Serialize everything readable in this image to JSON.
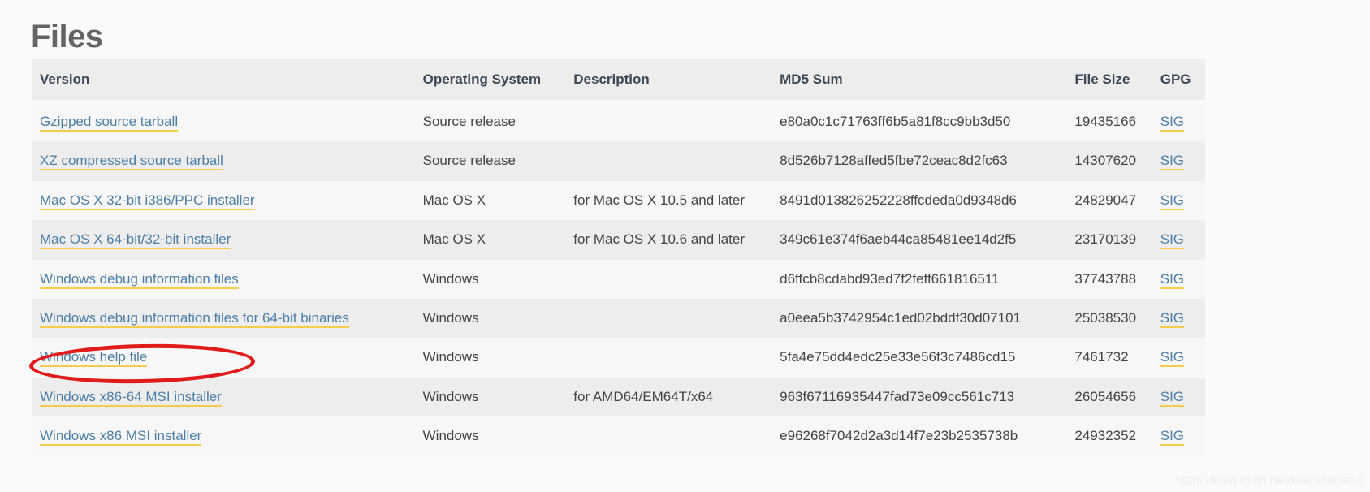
{
  "page": {
    "title": "Files",
    "watermark": "https://blog.csdn.net/lidahuilidahui",
    "accent_link_color": "#4b7fa8",
    "link_underline_color": "#f7cc4b",
    "annotation_color": "#e01b1b",
    "header_bg": "#ededed",
    "row_alt_bg": "#f7f7f7",
    "page_bg": "#fafafa"
  },
  "table": {
    "columns": [
      {
        "key": "version",
        "label": "Version"
      },
      {
        "key": "os",
        "label": "Operating System"
      },
      {
        "key": "description",
        "label": "Description"
      },
      {
        "key": "md5",
        "label": "MD5 Sum"
      },
      {
        "key": "filesize",
        "label": "File Size"
      },
      {
        "key": "gpg",
        "label": "GPG"
      }
    ],
    "gpg_link_label": "SIG",
    "rows": [
      {
        "version": "Gzipped source tarball",
        "os": "Source release",
        "description": "",
        "md5": "e80a0c1c71763ff6b5a81f8cc9bb3d50",
        "filesize": "19435166",
        "gpg": "SIG",
        "annotated": false
      },
      {
        "version": "XZ compressed source tarball",
        "os": "Source release",
        "description": "",
        "md5": "8d526b7128affed5fbe72ceac8d2fc63",
        "filesize": "14307620",
        "gpg": "SIG",
        "annotated": false
      },
      {
        "version": "Mac OS X 32-bit i386/PPC installer",
        "os": "Mac OS X",
        "description": "for Mac OS X 10.5 and later",
        "md5": "8491d013826252228ffcdeda0d9348d6",
        "filesize": "24829047",
        "gpg": "SIG",
        "annotated": false
      },
      {
        "version": "Mac OS X 64-bit/32-bit installer",
        "os": "Mac OS X",
        "description": "for Mac OS X 10.6 and later",
        "md5": "349c61e374f6aeb44ca85481ee14d2f5",
        "filesize": "23170139",
        "gpg": "SIG",
        "annotated": false
      },
      {
        "version": "Windows debug information files",
        "os": "Windows",
        "description": "",
        "md5": "d6ffcb8cdabd93ed7f2feff661816511",
        "filesize": "37743788",
        "gpg": "SIG",
        "annotated": false
      },
      {
        "version": "Windows debug information files for 64-bit binaries",
        "os": "Windows",
        "description": "",
        "md5": "a0eea5b3742954c1ed02bddf30d07101",
        "filesize": "25038530",
        "gpg": "SIG",
        "annotated": false
      },
      {
        "version": "Windows help file",
        "os": "Windows",
        "description": "",
        "md5": "5fa4e75dd4edc25e33e56f3c7486cd15",
        "filesize": "7461732",
        "gpg": "SIG",
        "annotated": false
      },
      {
        "version": "Windows x86-64 MSI installer",
        "os": "Windows",
        "description": "for AMD64/EM64T/x64",
        "md5": "963f67116935447fad73e09cc561c713",
        "filesize": "26054656",
        "gpg": "SIG",
        "annotated": true
      },
      {
        "version": "Windows x86 MSI installer",
        "os": "Windows",
        "description": "",
        "md5": "e96268f7042d2a3d14f7e23b2535738b",
        "filesize": "24932352",
        "gpg": "SIG",
        "annotated": false
      }
    ]
  }
}
